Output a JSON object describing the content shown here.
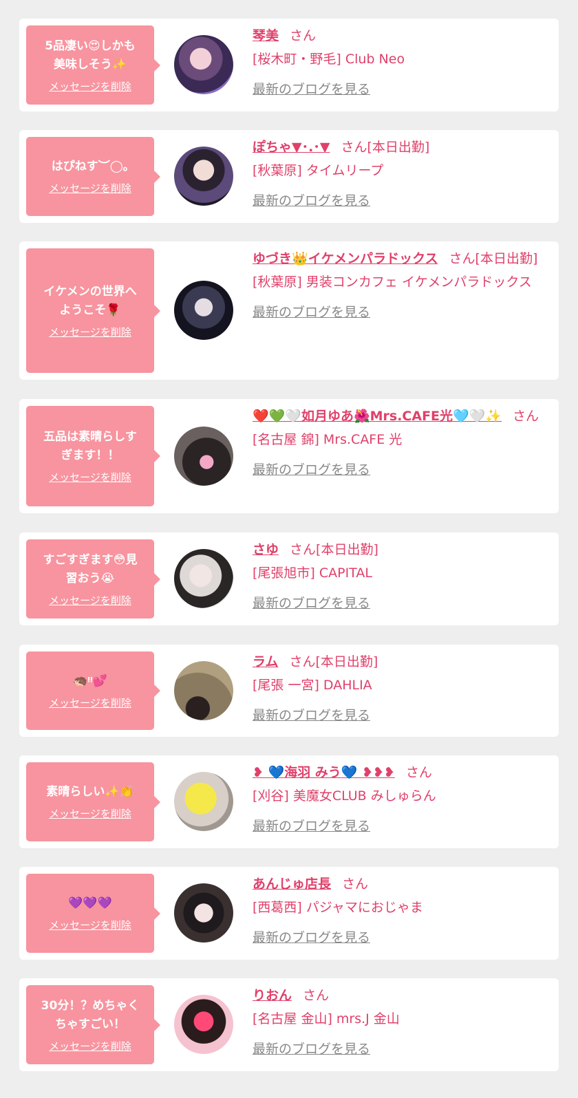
{
  "common": {
    "delete_label": "メッセージを削除",
    "blog_label": "最新のブログを見る",
    "honorific": "さん",
    "accent_color": "#e0406a",
    "bubble_color": "#f7949f"
  },
  "cards": [
    {
      "message": "5品凄い😍しかも\n美味しそう✨",
      "name": "琴美",
      "status": "",
      "shop": "[桜木町・野毛] Club Neo"
    },
    {
      "message": "はぴねす︶◯｡",
      "name": "ぽちゃ▼･.･▼",
      "status": "[本日出勤]",
      "shop": "[秋葉原] タイムリープ"
    },
    {
      "message": "イケメンの世界へ\nようこそ🌹",
      "name": "ゆづき👑イケメンパラドックス",
      "status": "[本日出勤]",
      "shop": "[秋葉原] 男装コンカフェ イケメンパラドックス"
    },
    {
      "message": "五品は素晴らしす\nぎます！！",
      "name": "❤️💚🤍如月ゆあ🌺Mrs.CAFE光🩵🤍✨",
      "status": "",
      "shop": "[名古屋 錦] Mrs.CAFE 光"
    },
    {
      "message": "すごすぎます😳見\n習おう😭",
      "name": "さゆ",
      "status": "[本日出勤]",
      "shop": "[尾張旭市] CAPITAL"
    },
    {
      "message": "🦔ᵎᵎ💕",
      "name": "ラム",
      "status": "[本日出勤]",
      "shop": "[尾張 一宮] DAHLIA"
    },
    {
      "message": "素晴らしい✨👏",
      "name": "❥ 💙海羽 みう💙 ❥❥❥",
      "status": "",
      "shop": "[刈谷] 美魔女CLUB みしゅらん"
    },
    {
      "message": "💜💜💜",
      "name": "あんじゅ店長",
      "status": "",
      "shop": "[西葛西] パジャマにおじゃま"
    },
    {
      "message": "30分！？めちゃく\nちゃすごい！",
      "name": "りおん",
      "status": "",
      "shop": "[名古屋 金山] mrs.J 金山"
    }
  ]
}
